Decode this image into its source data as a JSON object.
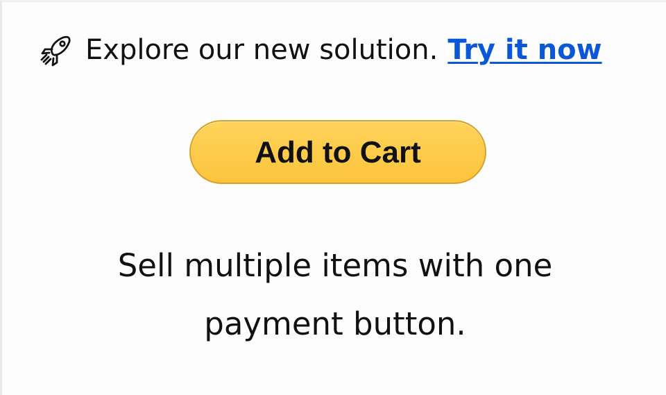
{
  "promo": {
    "icon": "rocket-icon",
    "text": "Explore our new solution.",
    "link_label": "Try it now",
    "link_color": "#0a57d8"
  },
  "button": {
    "label": "Add to Cart",
    "background_color": "#fcc43c",
    "border_color": "#d6a12a"
  },
  "description": {
    "line_1": "Sell multiple items with one",
    "line_2": "payment button."
  }
}
